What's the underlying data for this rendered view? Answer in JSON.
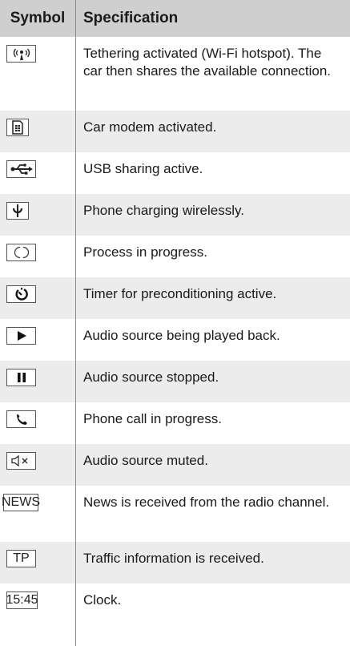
{
  "header": {
    "symbol": "Symbol",
    "specification": "Specification"
  },
  "rows": [
    {
      "icon": "wifi-hotspot-icon",
      "spec": "Tethering activated (Wi-Fi hotspot). The car then shares the available connection."
    },
    {
      "icon": "sim-card-icon",
      "spec": "Car modem activated."
    },
    {
      "icon": "usb-icon",
      "spec": "USB sharing active."
    },
    {
      "icon": "wireless-charging-icon",
      "spec": "Phone charging wirelessly."
    },
    {
      "icon": "progress-circle-icon",
      "spec": "Process in progress."
    },
    {
      "icon": "timer-icon",
      "spec": "Timer for preconditioning active."
    },
    {
      "icon": "play-icon",
      "spec": "Audio source being played back."
    },
    {
      "icon": "pause-icon",
      "spec": "Audio source stopped."
    },
    {
      "icon": "phone-icon",
      "spec": "Phone call in progress."
    },
    {
      "icon": "mute-icon",
      "spec": "Audio source muted."
    },
    {
      "icon": "news-icon",
      "label": "NEWS",
      "spec": "News is received from the radio channel."
    },
    {
      "icon": "traffic-info-icon",
      "label": "TP",
      "spec": "Traffic information is received."
    },
    {
      "icon": "clock-icon",
      "label": "15:45",
      "spec": "Clock."
    }
  ]
}
